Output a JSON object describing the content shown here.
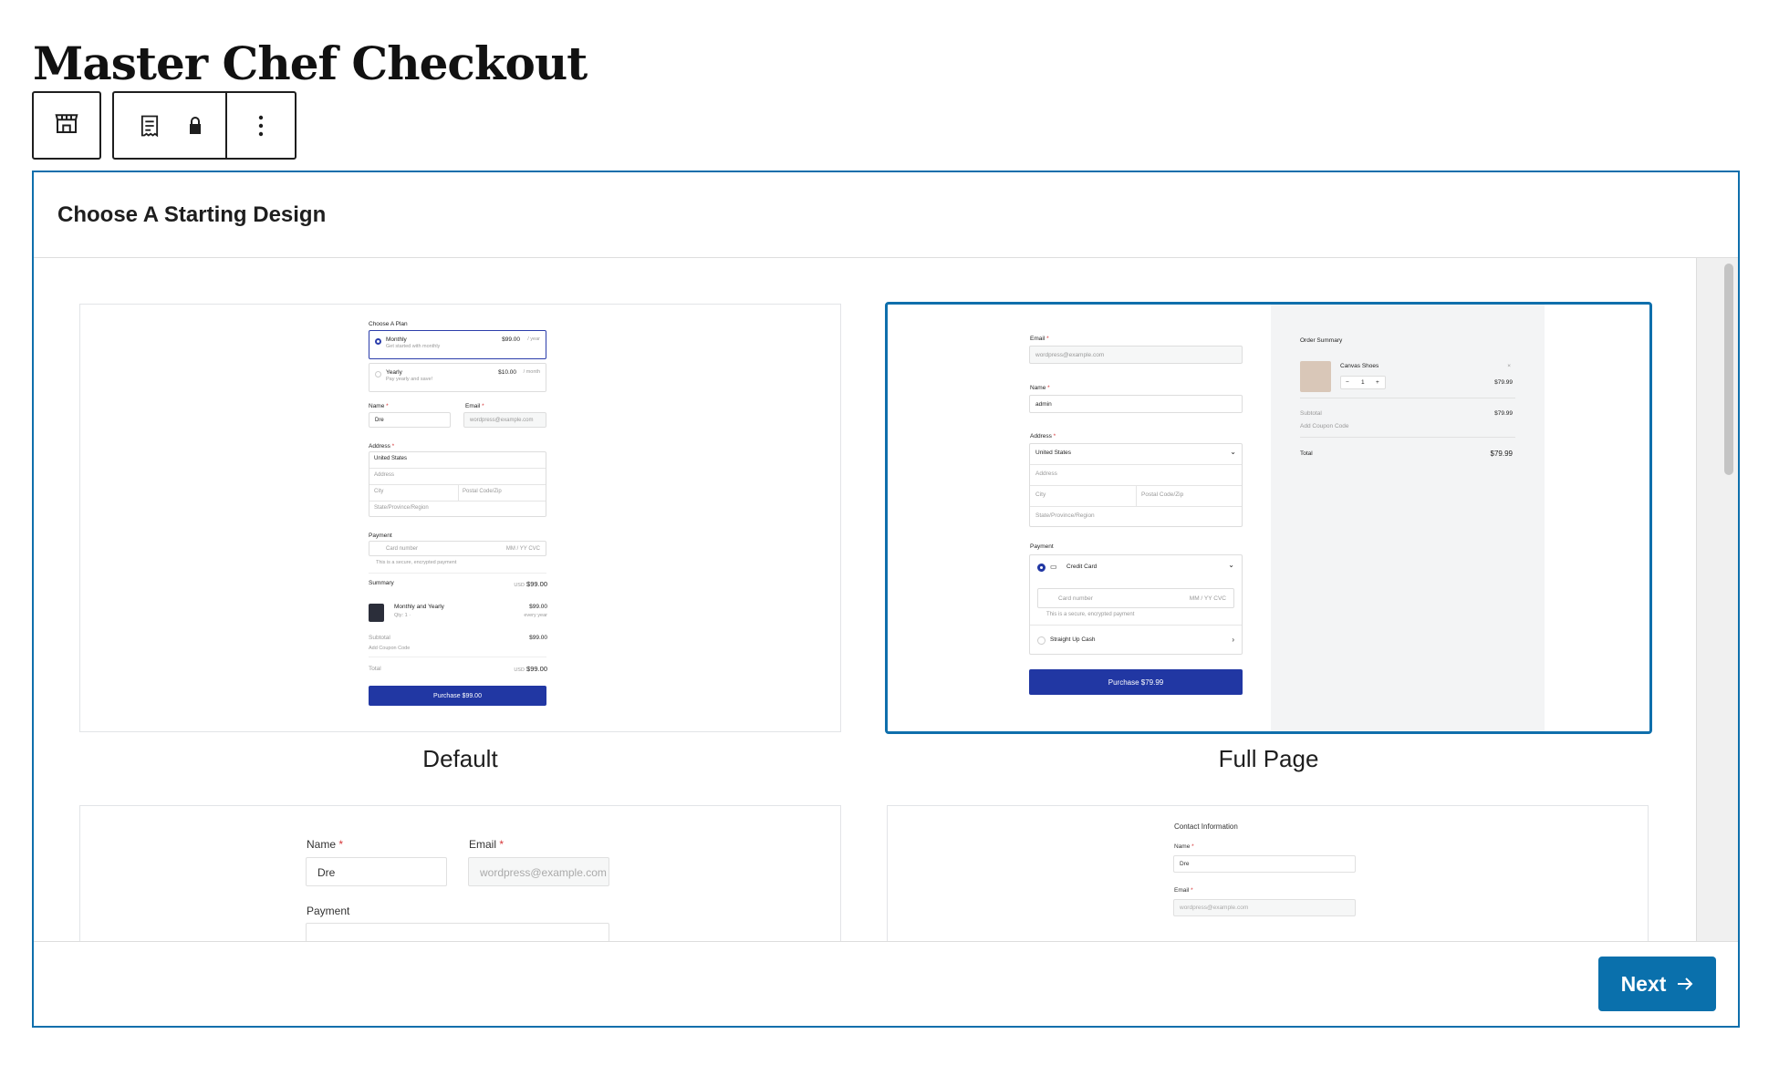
{
  "page": {
    "title": "Master Chef Checkout"
  },
  "toolbar": {
    "items": [
      "store-icon",
      "receipt-icon",
      "lock-icon",
      "more-vertical-icon"
    ]
  },
  "modal": {
    "title": "Choose A Starting Design",
    "next_label": "Next",
    "designs": [
      {
        "label": "Default"
      },
      {
        "label": "Full Page"
      }
    ]
  },
  "default_preview": {
    "choose_plan": "Choose A Plan",
    "monthly": "Monthly",
    "monthly_sub": "Get started with monthly",
    "monthly_price": "$99.00",
    "monthly_per": "/ year",
    "yearly": "Yearly",
    "yearly_sub": "Pay yearly and save!",
    "yearly_price": "$10.00",
    "yearly_per": "/ month",
    "name_label": "Name",
    "email_label": "Email",
    "name_value": "Dre",
    "email_placeholder": "wordpress@example.com",
    "address_label": "Address",
    "country": "United States",
    "address_placeholder": "Address",
    "city_placeholder": "City",
    "postal_placeholder": "Postal Code/Zip",
    "state_placeholder": "State/Province/Region",
    "payment_label": "Payment",
    "card_placeholder": "Card number",
    "card_exp": "MM / YY  CVC",
    "secure_note": "This is a secure, encrypted payment",
    "summary_label": "Summary",
    "summary_currency": "USD",
    "summary_total": "$99.00",
    "item_name": "Monthly and Yearly",
    "item_qty": "Qty: 1 ·",
    "item_price": "$99.00",
    "item_period": "every year",
    "subtotal_label": "Subtotal",
    "subtotal_value": "$99.00",
    "coupon_label": "Add Coupon Code",
    "total_label": "Total",
    "total_currency": "USD",
    "total_value": "$99.00",
    "purchase_label": "Purchase $99.00"
  },
  "fullpage_preview": {
    "email_label": "Email",
    "email_placeholder": "wordpress@example.com",
    "name_label": "Name",
    "name_value": "admin",
    "address_label": "Address",
    "country": "United States",
    "address_placeholder": "Address",
    "city_placeholder": "City",
    "postal_placeholder": "Postal Code/Zip",
    "state_placeholder": "State/Province/Region",
    "payment_label": "Payment",
    "credit_card": "Credit Card",
    "card_placeholder": "Card number",
    "card_exp": "MM / YY  CVC",
    "secure_note": "This is a secure, encrypted payment",
    "cash": "Straight Up Cash",
    "purchase_label": "Purchase $79.99",
    "order_summary": "Order Summary",
    "product": "Canvas Shoes",
    "qty": "1",
    "product_price": "$79.99",
    "subtotal_label": "Subtotal",
    "subtotal_value": "$79.99",
    "coupon_label": "Add Coupon Code",
    "total_label": "Total",
    "total_value": "$79.99"
  },
  "preview3": {
    "name_label": "Name",
    "email_label": "Email",
    "name_value": "Dre",
    "email_placeholder": "wordpress@example.com",
    "payment_label": "Payment"
  },
  "preview4": {
    "contact_info": "Contact Information",
    "name_label": "Name",
    "name_value": "Dre",
    "email_label": "Email",
    "email_placeholder": "wordpress@example.com"
  }
}
